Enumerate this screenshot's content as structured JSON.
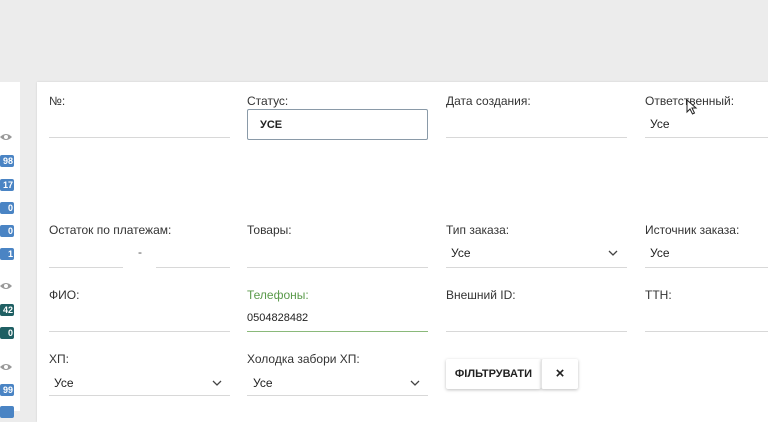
{
  "left_badges": [
    {
      "text": "98",
      "color": "#4a84c4"
    },
    {
      "text": "17",
      "color": "#4a84c4"
    },
    {
      "text": "0",
      "color": "#4a84c4"
    },
    {
      "text": "0",
      "color": "#4a84c4"
    },
    {
      "text": "1",
      "color": "#4a84c4"
    },
    {
      "text": "42",
      "color": "#1f5f63"
    },
    {
      "text": "0",
      "color": "#1f5f63"
    },
    {
      "text": "99",
      "color": "#4a84c4"
    }
  ],
  "filters": {
    "number": {
      "label": "№:",
      "value": ""
    },
    "status": {
      "label": "Статус:",
      "value": "УСЕ"
    },
    "created_date": {
      "label": "Дата создания:",
      "value": ""
    },
    "responsible": {
      "label": "Ответственный:",
      "value": "Усе"
    },
    "payment_balance": {
      "label": "Остаток по платежам:",
      "separator": "-"
    },
    "goods": {
      "label": "Товары:",
      "value": ""
    },
    "order_type": {
      "label": "Тип заказа:",
      "value": "Усе"
    },
    "order_source": {
      "label": "Источник заказа:",
      "value": "Усе"
    },
    "full_name": {
      "label": "ФИО:",
      "value": ""
    },
    "phones": {
      "label": "Телефоны:",
      "value": "0504828482"
    },
    "external_id": {
      "label": "Внешний ID:",
      "value": ""
    },
    "ttn": {
      "label": "ТТН:",
      "value": ""
    },
    "xp": {
      "label": "ХП:",
      "value": "Усе"
    },
    "cold_pickup_xp": {
      "label": "Холодка забори ХП:",
      "value": "Усе"
    }
  },
  "actions": {
    "filter_label": "ФІЛЬТРУВАТИ",
    "clear_symbol": "×"
  },
  "colors": {
    "active_label": "#5a9a4a",
    "badge_blue": "#4a84c4",
    "badge_teal": "#1f5f63"
  }
}
